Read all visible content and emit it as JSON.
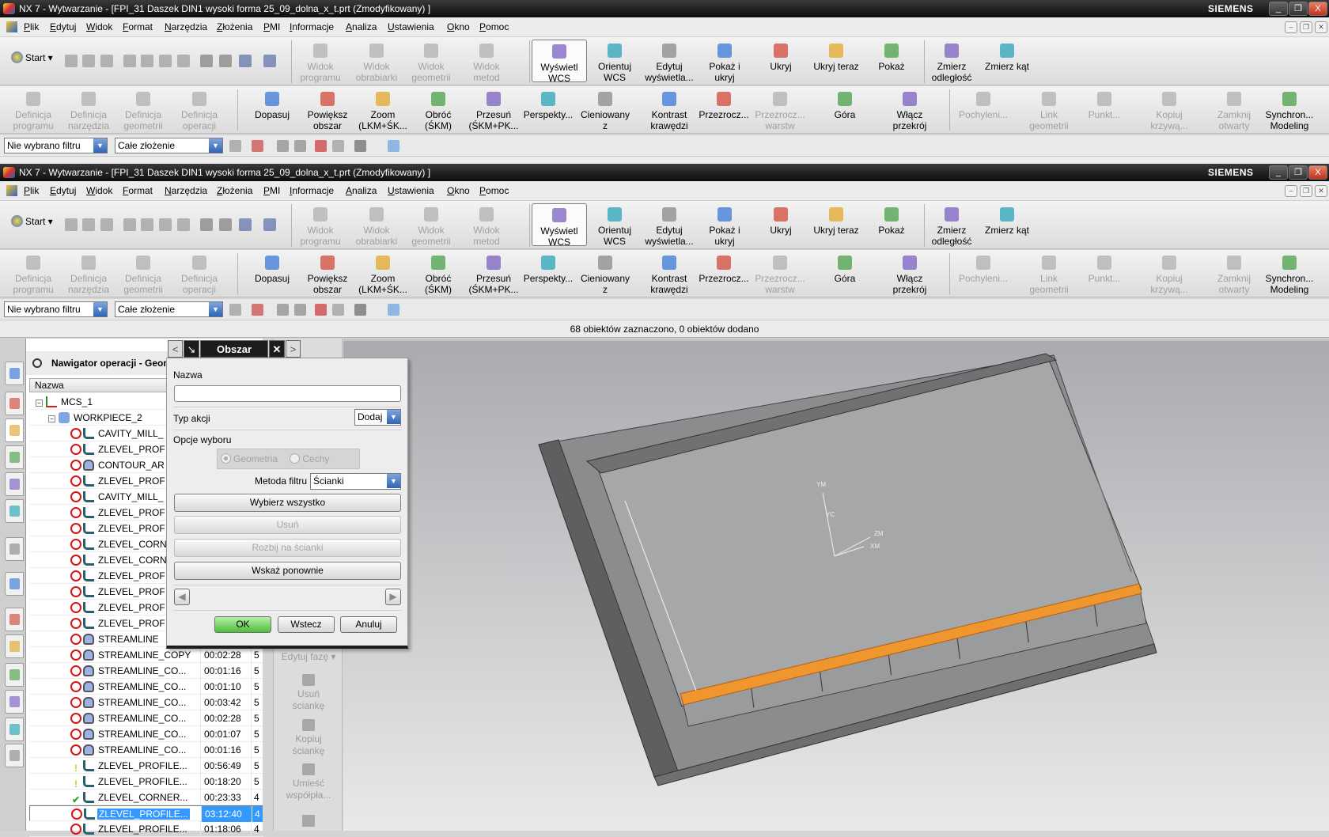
{
  "window": {
    "title": "NX 7 - Wytwarzanie - [FPI_31 Daszek DIN1 wysoki forma 25_09_dolna_x_t.prt (Zmodyfikowany) ]",
    "brand": "SIEMENS",
    "controls": {
      "minimize": "_",
      "restore": "❐",
      "close": "X"
    }
  },
  "menu": [
    "Plik",
    "Edytuj",
    "Widok",
    "Format",
    "Narzędzia",
    "Złożenia",
    "PMI",
    "Informacje",
    "Analiza",
    "Ustawienia",
    "Okno",
    "Pomoc"
  ],
  "toolbar1": {
    "start_label": "Start",
    "small_icons": [
      "new-icon",
      "open-icon",
      "save-icon",
      "cut-icon",
      "copy-icon",
      "paste-icon",
      "delete-icon",
      "undo-icon",
      "redo-icon",
      "info-icon",
      "binoculars-icon"
    ],
    "items": [
      {
        "label": "Widok\nprogramu",
        "icon": "program-view-icon",
        "disabled": true
      },
      {
        "label": "Widok\nobrabiarki",
        "icon": "machine-view-icon",
        "disabled": true
      },
      {
        "label": "Widok\ngeometrii",
        "icon": "geometry-view-icon",
        "disabled": true
      },
      {
        "label": "Widok\nmetod",
        "icon": "method-view-icon",
        "disabled": true
      },
      {
        "label": "Wyświetl\nWCS",
        "icon": "wcs-display-icon",
        "disabled": false,
        "active": true
      },
      {
        "label": "Orientuj\nWCS",
        "icon": "wcs-orient-icon",
        "disabled": false
      },
      {
        "label": "Edytuj\nwyświetla...",
        "icon": "edit-display-icon",
        "disabled": false
      },
      {
        "label": "Pokaż i\nukryj",
        "icon": "show-hide-icon",
        "disabled": false
      },
      {
        "label": "Ukryj",
        "icon": "hide-icon",
        "disabled": false
      },
      {
        "label": "Ukryj teraz",
        "icon": "immediate-hide-icon",
        "disabled": false
      },
      {
        "label": "Pokaż",
        "icon": "show-icon",
        "disabled": false
      },
      {
        "label": "Zmierz\nodległość",
        "icon": "measure-distance-icon",
        "disabled": false
      },
      {
        "label": "Zmierz kąt",
        "icon": "measure-angle-icon",
        "disabled": false
      }
    ]
  },
  "toolbar2": {
    "items": [
      {
        "label": "Definicja\nprogramu",
        "icon": "create-program-icon",
        "disabled": true
      },
      {
        "label": "Definicja\nnarzędzia",
        "icon": "create-tool-icon",
        "disabled": true
      },
      {
        "label": "Definicja\ngeometrii",
        "icon": "create-geometry-icon",
        "disabled": true
      },
      {
        "label": "Definicja\noperacji",
        "icon": "create-operation-icon",
        "disabled": true
      },
      {
        "label": "Dopasuj",
        "icon": "fit-icon",
        "disabled": false
      },
      {
        "label": "Powiększ\nobszar",
        "icon": "zoom-area-icon",
        "disabled": false
      },
      {
        "label": "Zoom\n(LKM+ŚK...",
        "icon": "zoom-icon",
        "disabled": false
      },
      {
        "label": "Obróć\n(ŚKM)",
        "icon": "rotate-icon",
        "disabled": false
      },
      {
        "label": "Przesuń\n(ŚKM+PK...",
        "icon": "pan-icon",
        "disabled": false
      },
      {
        "label": "Perspekty...",
        "icon": "perspective-icon",
        "disabled": false
      },
      {
        "label": "Cieniowany\nz",
        "icon": "shaded-icon",
        "disabled": false
      },
      {
        "label": "Kontrast\nkrawędzi",
        "icon": "edge-contrast-icon",
        "disabled": false
      },
      {
        "label": "Przezrocz...",
        "icon": "translucency-icon",
        "disabled": false
      },
      {
        "label": "Przezrocz...\nwarstw",
        "icon": "layer-translucency-icon",
        "disabled": true
      },
      {
        "label": "Góra",
        "icon": "top-view-icon",
        "disabled": false
      },
      {
        "label": "Włącz\nprzekrój",
        "icon": "section-icon",
        "disabled": false
      },
      {
        "label": "Pochyleni...",
        "icon": "draft-icon",
        "disabled": true
      },
      {
        "label": "Link\ngeometrii",
        "icon": "wave-link-icon",
        "disabled": true
      },
      {
        "label": "Punkt...",
        "icon": "point-icon",
        "disabled": true
      },
      {
        "label": "Kopiuj\nkrzywą...",
        "icon": "copy-curve-icon",
        "disabled": true
      },
      {
        "label": "Zamknij\notwarty",
        "icon": "close-open-icon",
        "disabled": true
      },
      {
        "label": "Synchron...\nModeling",
        "icon": "synchronous-modeling-icon",
        "disabled": false
      }
    ]
  },
  "filter": {
    "type_filter": "Nie wybrano filtru",
    "scope": "Całe złożenie"
  },
  "status": "68 obiektów zaznaczono, 0 obiektów dodano",
  "navigator": {
    "title": "Nawigator operacji - Geom",
    "column_name": "Nazwa",
    "rows": [
      {
        "name": "MCS_1",
        "level": 0,
        "kind": "mcs"
      },
      {
        "name": "WORKPIECE_2",
        "level": 1,
        "kind": "workpiece"
      },
      {
        "name": "CAVITY_MILL_",
        "level": 2,
        "kind": "zlevel",
        "status": "excluded"
      },
      {
        "name": "ZLEVEL_PROF",
        "level": 2,
        "kind": "zlevel",
        "status": "excluded"
      },
      {
        "name": "CONTOUR_AR",
        "level": 2,
        "kind": "stream",
        "status": "excluded"
      },
      {
        "name": "ZLEVEL_PROF",
        "level": 2,
        "kind": "zlevel",
        "status": "excluded"
      },
      {
        "name": "CAVITY_MILL_",
        "level": 2,
        "kind": "zlevel",
        "status": "excluded"
      },
      {
        "name": "ZLEVEL_PROF",
        "level": 2,
        "kind": "zlevel",
        "status": "excluded"
      },
      {
        "name": "ZLEVEL_PROF",
        "level": 2,
        "kind": "zlevel",
        "status": "excluded"
      },
      {
        "name": "ZLEVEL_CORN",
        "level": 2,
        "kind": "zlevel",
        "status": "excluded"
      },
      {
        "name": "ZLEVEL_CORN",
        "level": 2,
        "kind": "zlevel",
        "status": "excluded"
      },
      {
        "name": "ZLEVEL_PROF",
        "level": 2,
        "kind": "zlevel",
        "status": "excluded"
      },
      {
        "name": "ZLEVEL_PROF",
        "level": 2,
        "kind": "zlevel",
        "status": "excluded"
      },
      {
        "name": "ZLEVEL_PROF",
        "level": 2,
        "kind": "zlevel",
        "status": "excluded"
      },
      {
        "name": "ZLEVEL_PROF",
        "level": 2,
        "kind": "zlevel",
        "status": "excluded"
      },
      {
        "name": "STREAMLINE",
        "level": 2,
        "kind": "stream",
        "status": "excluded"
      },
      {
        "name": "STREAMLINE_COPY",
        "time": "00:02:28",
        "col3": "5",
        "level": 2,
        "kind": "stream",
        "status": "excluded"
      },
      {
        "name": "STREAMLINE_CO...",
        "time": "00:01:16",
        "col3": "5",
        "level": 2,
        "kind": "stream",
        "status": "excluded"
      },
      {
        "name": "STREAMLINE_CO...",
        "time": "00:01:10",
        "col3": "5",
        "level": 2,
        "kind": "stream",
        "status": "excluded"
      },
      {
        "name": "STREAMLINE_CO...",
        "time": "00:03:42",
        "col3": "5",
        "level": 2,
        "kind": "stream",
        "status": "excluded"
      },
      {
        "name": "STREAMLINE_CO...",
        "time": "00:02:28",
        "col3": "5",
        "level": 2,
        "kind": "stream",
        "status": "excluded"
      },
      {
        "name": "STREAMLINE_CO...",
        "time": "00:01:07",
        "col3": "5",
        "level": 2,
        "kind": "stream",
        "status": "excluded"
      },
      {
        "name": "STREAMLINE_CO...",
        "time": "00:01:16",
        "col3": "5",
        "level": 2,
        "kind": "stream",
        "status": "excluded"
      },
      {
        "name": "ZLEVEL_PROFILE...",
        "time": "00:56:49",
        "col3": "5",
        "level": 2,
        "kind": "zlevel",
        "status": "warning"
      },
      {
        "name": "ZLEVEL_PROFILE...",
        "time": "00:18:20",
        "col3": "5",
        "level": 2,
        "kind": "zlevel",
        "status": "warning"
      },
      {
        "name": "ZLEVEL_CORNER...",
        "time": "00:23:33",
        "col3": "4",
        "level": 2,
        "kind": "zlevel",
        "status": "ok"
      },
      {
        "name": "ZLEVEL_PROFILE...",
        "time": "03:12:40",
        "col3": "4",
        "level": 2,
        "kind": "zlevel",
        "status": "excluded",
        "selected": true
      },
      {
        "name": "ZLEVEL_PROFILE...",
        "time": "01:18:06",
        "col3": "4",
        "level": 2,
        "kind": "zlevel",
        "status": "excluded"
      }
    ]
  },
  "resource_bar": [
    {
      "label": "Edytuj fazę",
      "icon": "edit-phase-icon"
    },
    {
      "label": "Usuń\nściankę",
      "icon": "delete-face-icon"
    },
    {
      "label": "Kopiuj\nściankę",
      "icon": "copy-face-icon"
    },
    {
      "label": "Umieść\nwspółpła...",
      "icon": "place-coplanar-icon"
    }
  ],
  "viewport": {
    "axis_labels": [
      "YM",
      "YC",
      "ZM",
      "XM"
    ],
    "highlight_color": "#f0962e"
  },
  "dialog": {
    "title": "Obszar obróbki",
    "name_label": "Nazwa",
    "name_value": "",
    "action_label": "Typ akcji",
    "action_value": "Dodaj",
    "selection_options_label": "Opcje wyboru",
    "radio_geometry": "Geometria",
    "radio_features": "Cechy",
    "filter_method_label": "Metoda filtru",
    "filter_method_value": "Ścianki",
    "select_all": "Wybierz wszystko",
    "remove": "Usuń",
    "split_faces": "Rozbij na ścianki",
    "reselect": "Wskaż ponownie",
    "ok": "OK",
    "back": "Wstecz",
    "cancel": "Anuluj"
  }
}
